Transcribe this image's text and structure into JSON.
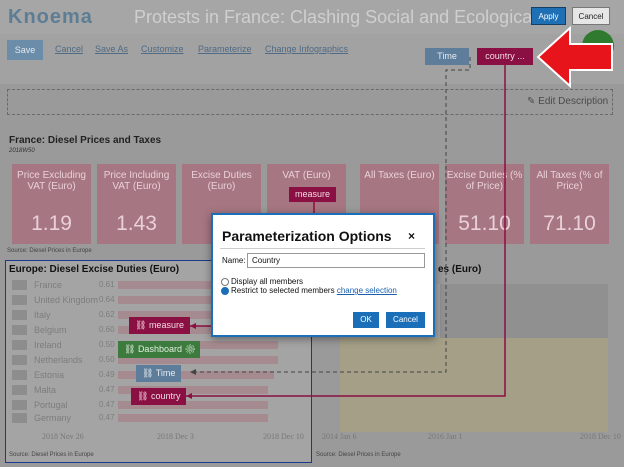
{
  "header": {
    "logo": "Knoema",
    "title": "Protests in France: Clashing Social and Ecological Demands",
    "apply_label": "Apply",
    "cancel_label": "Cancel"
  },
  "toolbar": {
    "save_label": "Save",
    "links": [
      "Cancel",
      "Save As",
      "Customize",
      "Parameterize",
      "Change Infographics"
    ],
    "time_param": "Time",
    "country_param": "country ..."
  },
  "description": {
    "edit_label": "✎ Edit Description"
  },
  "france": {
    "title": "France: Diesel Prices and Taxes",
    "subtitle": "2018W50",
    "tiles": [
      {
        "label": "Price Excluding VAT (Euro)",
        "value": "1.19"
      },
      {
        "label": "Price Including VAT (Euro)",
        "value": "1.43"
      },
      {
        "label": "Excise Duties (Euro)",
        "value": ""
      },
      {
        "label": "VAT (Euro)",
        "value": ""
      },
      {
        "label": "All Taxes (Euro)",
        "value": ""
      },
      {
        "label": "Excise Duties (% of Price)",
        "value": "51.10"
      },
      {
        "label": "All Taxes (% of Price)",
        "value": "71.10"
      }
    ],
    "measure_tag": "measure",
    "source": "Source: Diesel Prices in Europe"
  },
  "europe": {
    "title": "Europe: Diesel Excise Duties (Euro)",
    "rows": [
      {
        "country": "France",
        "value": "0.61"
      },
      {
        "country": "United Kingdom",
        "value": "0.64"
      },
      {
        "country": "Italy",
        "value": "0.62"
      },
      {
        "country": "Belgium",
        "value": "0.60"
      },
      {
        "country": "Ireland",
        "value": "0.50"
      },
      {
        "country": "Netherlands",
        "value": "0.50"
      },
      {
        "country": "Estonia",
        "value": "0.49"
      },
      {
        "country": "Malta",
        "value": "0.47"
      },
      {
        "country": "Portugal",
        "value": "0.47"
      },
      {
        "country": "Germany",
        "value": "0.47"
      }
    ],
    "x_ticks": [
      "2018 Nov 26",
      "2018 Dec 3",
      "2018 Dec 10"
    ],
    "source": "Source: Diesel Prices in Europe"
  },
  "right_chart": {
    "title": "es (Euro)",
    "x_ticks": [
      "2014 Jan 6",
      "2016 Jan 1",
      "2018 Dec 10"
    ],
    "source": "Source: Diesel Prices in Europe"
  },
  "chips": {
    "measure": "measure",
    "dashboard": "Dashboard",
    "time": "Time",
    "country": "country"
  },
  "modal": {
    "title": "Parameterization Options",
    "close": "×",
    "name_label": "Name:",
    "name_value": "Country",
    "option_all": "Display all members",
    "option_selected": "Restrict to selected members",
    "change_link": "change selection",
    "ok_label": "OK",
    "cancel_label": "Cancel"
  },
  "colors": {
    "accent": "#1a6fb8",
    "param_maroon": "#8a0f42",
    "param_blue": "#5d7d9a",
    "arrow_red": "#e8141b"
  }
}
